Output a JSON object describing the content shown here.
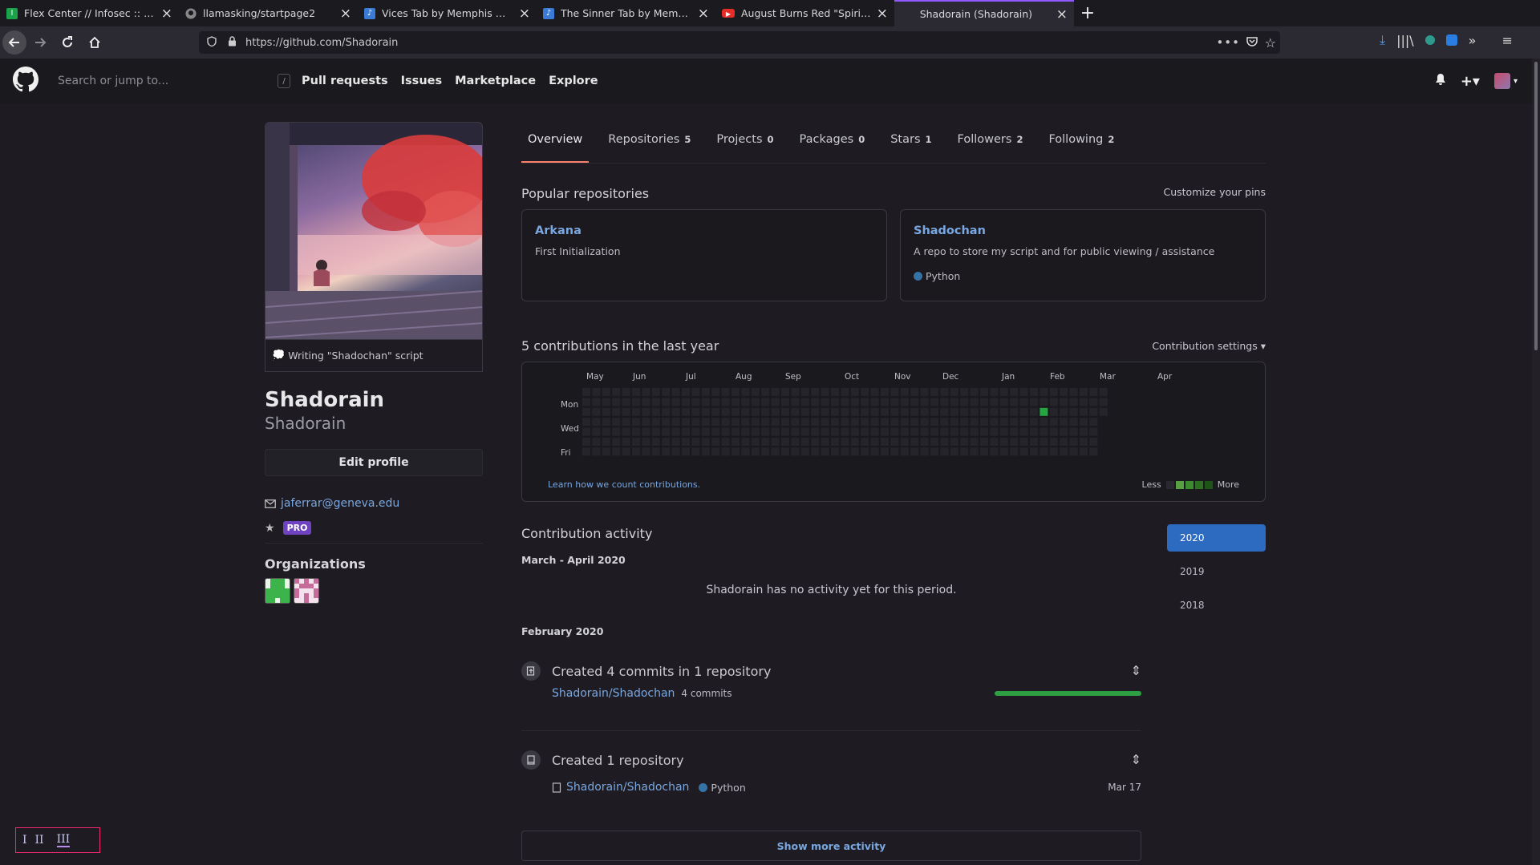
{
  "browser": {
    "tabs": [
      {
        "title": "Flex Center // Infosec :: User",
        "favicon_color": "#1aa34a",
        "favicon_letter": "I"
      },
      {
        "title": "llamasking/startpage2",
        "favicon_color": "#2e2e33",
        "favicon_letter": ""
      },
      {
        "title": "Vices Tab by Memphis May Fi",
        "favicon_color": "#3a7bd5",
        "favicon_letter": "♪"
      },
      {
        "title": "The Sinner Tab by Memphis M",
        "favicon_color": "#3a7bd5",
        "favicon_letter": "♪"
      },
      {
        "title": "August Burns Red \"Spirit Bre",
        "favicon_color": "#e52d27",
        "favicon_letter": "▶"
      },
      {
        "title": "Shadorain (Shadorain)",
        "favicon_color": "",
        "favicon_letter": "",
        "active": true
      }
    ],
    "url": "https://github.com/Shadorain"
  },
  "github": {
    "search_placeholder": "Search or jump to...",
    "slash_key": "/",
    "nav": [
      "Pull requests",
      "Issues",
      "Marketplace",
      "Explore"
    ]
  },
  "profile": {
    "status": "Writing \"Shadochan\" script",
    "name": "Shadorain",
    "login": "Shadorain",
    "edit_label": "Edit profile",
    "email": "jaferrar@geneva.edu",
    "pro_label": "PRO",
    "orgs_title": "Organizations"
  },
  "tabs": [
    {
      "label": "Overview",
      "count": ""
    },
    {
      "label": "Repositories",
      "count": "5"
    },
    {
      "label": "Projects",
      "count": "0"
    },
    {
      "label": "Packages",
      "count": "0"
    },
    {
      "label": "Stars",
      "count": "1"
    },
    {
      "label": "Followers",
      "count": "2"
    },
    {
      "label": "Following",
      "count": "2"
    }
  ],
  "popular": {
    "title": "Popular repositories",
    "customize": "Customize your pins",
    "repos": [
      {
        "name": "Arkana",
        "desc": "First Initialization",
        "lang": ""
      },
      {
        "name": "Shadochan",
        "desc": "A repo to store my script and for public viewing / assistance",
        "lang": "Python"
      }
    ]
  },
  "contrib": {
    "title": "5 contributions in the last year",
    "settings": "Contribution settings ▾",
    "months": [
      "May",
      "Jun",
      "Jul",
      "Aug",
      "Sep",
      "Oct",
      "Nov",
      "Dec",
      "Jan",
      "Feb",
      "Mar",
      "Apr"
    ],
    "days": [
      "Mon",
      "Wed",
      "Fri"
    ],
    "learn": "Learn how we count contributions.",
    "less": "Less",
    "more": "More",
    "level_colors": [
      "#2a2830",
      "#0e4429",
      "#26a641",
      "#39d353",
      "#4ae168"
    ]
  },
  "activity": {
    "title": "Contribution activity",
    "period1": "March - April 2020",
    "no_activity": "Shadorain has no activity yet for this period.",
    "period2": "February 2020",
    "commits_label": "Created 4 commits in 1 repository",
    "commits_repo": "Shadorain/Shadochan",
    "commits_count": "4 commits",
    "repo_label": "Created 1 repository",
    "repo_link": "Shadorain/Shadochan",
    "repo_lang": "Python",
    "repo_date": "Mar 17",
    "show_more": "Show more activity",
    "years": [
      "2020",
      "2019",
      "2018"
    ]
  },
  "corner_widget": [
    "I",
    "II",
    "III"
  ]
}
